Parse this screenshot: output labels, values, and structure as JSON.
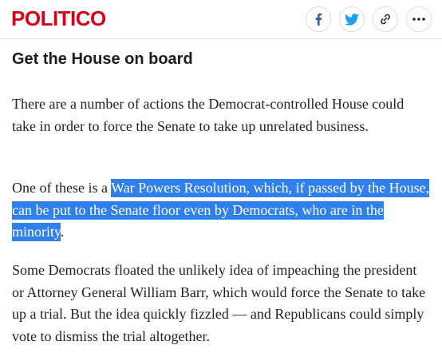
{
  "header": {
    "logo": "POLITICO",
    "share_buttons": [
      {
        "icon": "facebook-icon",
        "color": "#3b5998"
      },
      {
        "icon": "twitter-icon",
        "color": "#1da1f2"
      },
      {
        "icon": "link-icon",
        "color": "#222222"
      },
      {
        "icon": "more-icon",
        "color": "#222222"
      }
    ]
  },
  "article": {
    "section_heading": "Get the House on board",
    "paragraph_1": "There are a number of actions the Democrat-controlled House could take in order to force the Senate to take up unrelated business.",
    "paragraph_2_before": "One of these is a ",
    "paragraph_2_highlight": "War Powers Resolution, which, if passed by the House, can be put to the Senate floor even by Democrats, who are in the minority",
    "paragraph_2_after": ".",
    "paragraph_3": "Some Democrats floated the unlikely idea of impeaching the president or Attorney General William Barr, which would force the Senate to take up a trial. But the idea quickly fizzled — and Republicans could simply vote to dismiss the trial altogether."
  },
  "colors": {
    "brand": "#d6001c",
    "selection": "#2f80ed"
  }
}
